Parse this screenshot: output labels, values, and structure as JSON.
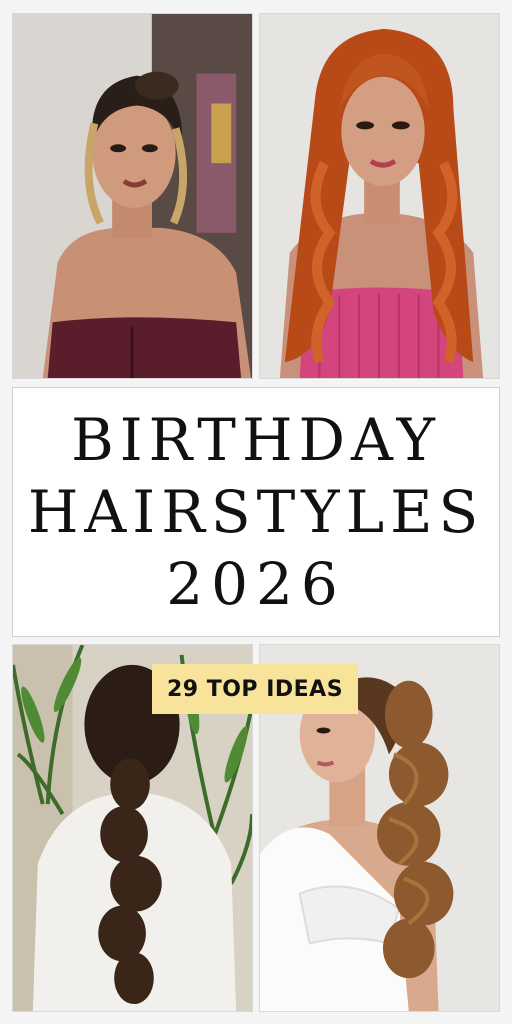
{
  "title": {
    "line1": "BIRTHDAY",
    "line2": "HAIRSTYLES",
    "line3": "2026"
  },
  "badge": {
    "text": "29 TOP IDEAS"
  },
  "colors": {
    "badge_bg": "#f7e39a",
    "title_text": "#111111",
    "page_bg": "#f4f4f4"
  },
  "photos": [
    {
      "subject": "woman with blonde-highlighted updo and burgundy corset top"
    },
    {
      "subject": "woman with long copper-red curls and pink top"
    },
    {
      "subject": "back view of long dark bubble ponytail in white sweater"
    },
    {
      "subject": "woman with high brunette wavy ponytail and white top"
    }
  ]
}
